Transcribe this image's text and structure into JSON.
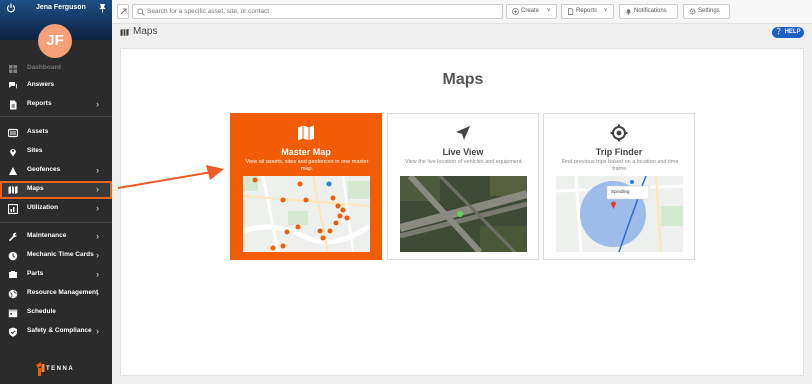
{
  "user": {
    "name": "Jena Ferguson",
    "initials": "JF"
  },
  "sidebar": {
    "items": [
      {
        "label": "Dashboard",
        "icon": "dashboard-icon",
        "chevron": false,
        "state": "faded"
      },
      {
        "label": "Answers",
        "icon": "answers-icon",
        "chevron": false,
        "state": "normal"
      },
      {
        "label": "Reports",
        "icon": "reports-icon",
        "chevron": true,
        "state": "normal"
      },
      {
        "label": "Assets",
        "icon": "assets-icon",
        "chevron": false,
        "state": "normal"
      },
      {
        "label": "Sites",
        "icon": "location-pin-icon",
        "chevron": false,
        "state": "normal"
      },
      {
        "label": "Geofences",
        "icon": "geofence-icon",
        "chevron": true,
        "state": "normal"
      },
      {
        "label": "Maps",
        "icon": "map-icon",
        "chevron": true,
        "state": "active"
      },
      {
        "label": "Utilization",
        "icon": "utilization-icon",
        "chevron": true,
        "state": "normal"
      },
      {
        "label": "Maintenance",
        "icon": "wrench-icon",
        "chevron": true,
        "state": "normal"
      },
      {
        "label": "Mechanic Time Cards",
        "icon": "clock-icon",
        "chevron": true,
        "state": "normal"
      },
      {
        "label": "Parts",
        "icon": "parts-icon",
        "chevron": true,
        "state": "normal"
      },
      {
        "label": "Resource Management",
        "icon": "globe-icon",
        "chevron": true,
        "state": "normal"
      },
      {
        "label": "Schedule",
        "icon": "calendar-icon",
        "chevron": false,
        "state": "normal"
      },
      {
        "label": "Safety & Compliance",
        "icon": "shield-icon",
        "chevron": true,
        "state": "normal"
      }
    ],
    "logo_text": "TENNA"
  },
  "topbar": {
    "search_placeholder": "Search for a specific asset, site, or contact",
    "create_label": "Create",
    "reports_label": "Reports",
    "notifications_label": "Notifications",
    "settings_label": "Settings"
  },
  "page": {
    "title": "Maps",
    "help_label": "HELP"
  },
  "main": {
    "heading": "Maps",
    "tiles": [
      {
        "title": "Master Map",
        "description": "View all assets, sites and geofences in one master map.",
        "icon": "map-icon",
        "selected": true
      },
      {
        "title": "Live View",
        "description": "View the live location of vehicles and equipment.",
        "icon": "navigation-arrow-icon",
        "selected": false
      },
      {
        "title": "Trip Finder",
        "description": "Find previous trips based on a location and time frame.",
        "icon": "crosshair-icon",
        "selected": false
      }
    ],
    "trip_popup_label": "Spindling"
  },
  "colors": {
    "accent": "#f25c05",
    "sidebar": "#2b2b2b",
    "help": "#1a60c6"
  }
}
